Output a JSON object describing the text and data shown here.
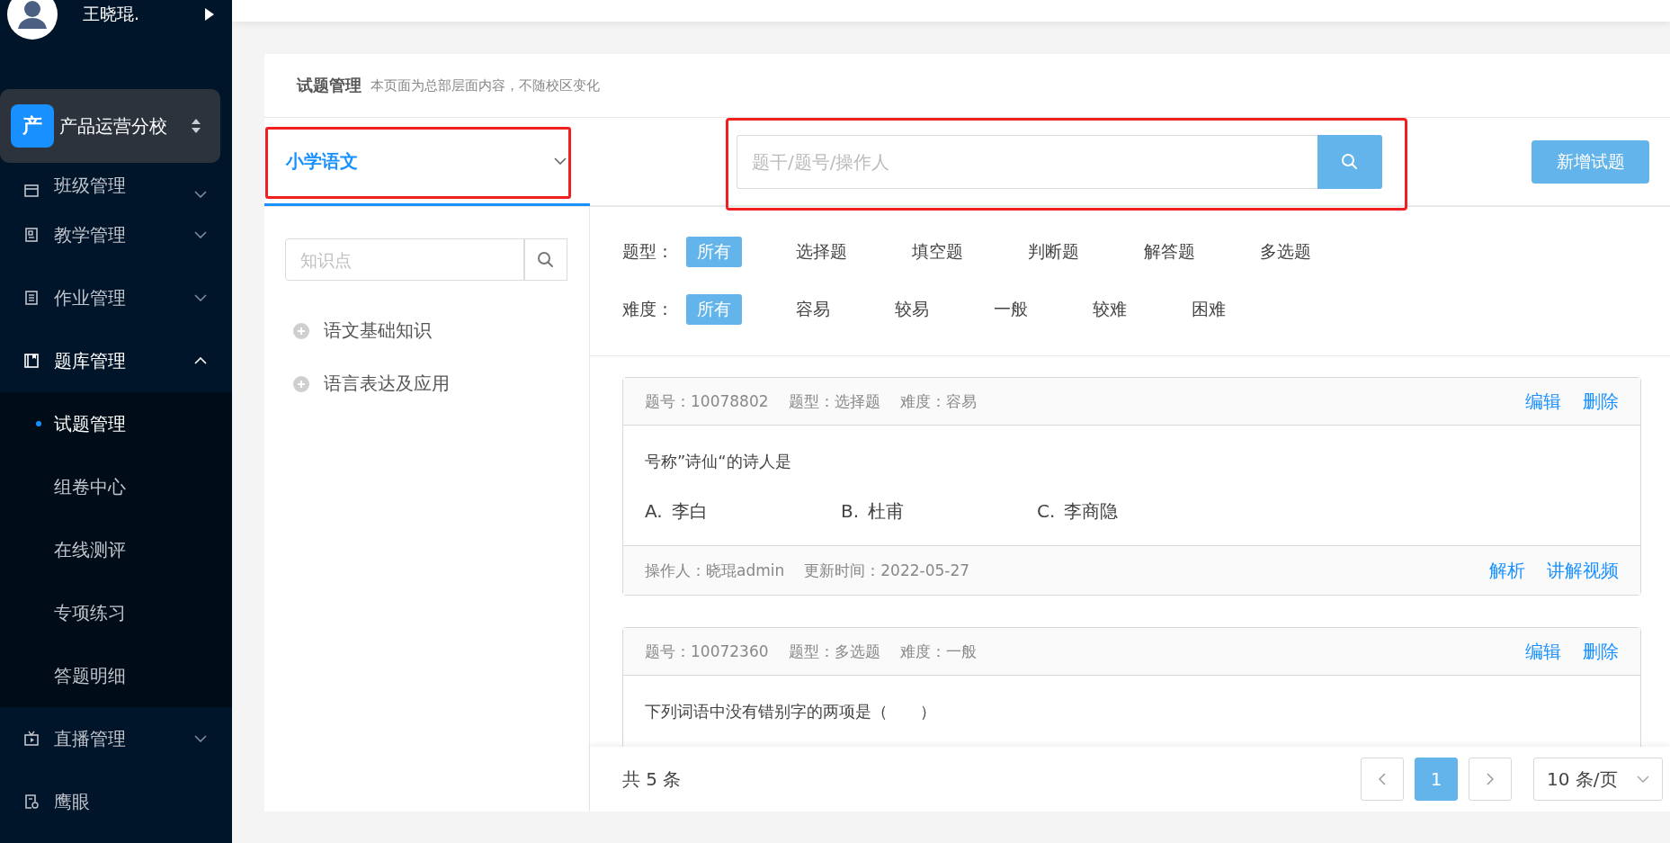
{
  "user": {
    "name": "王晓琨."
  },
  "school": {
    "badge": "产",
    "name": "产品运营分校"
  },
  "menu": [
    {
      "label": "班级管理",
      "expanded": false
    },
    {
      "label": "教学管理",
      "expanded": false
    },
    {
      "label": "作业管理",
      "expanded": false
    },
    {
      "label": "题库管理",
      "expanded": true,
      "children": [
        {
          "label": "试题管理",
          "selected": true
        },
        {
          "label": "组卷中心",
          "selected": false
        },
        {
          "label": "在线测评",
          "selected": false
        },
        {
          "label": "专项练习",
          "selected": false
        },
        {
          "label": "答题明细",
          "selected": false
        }
      ]
    },
    {
      "label": "直播管理",
      "expanded": false
    },
    {
      "label": "鹰眼"
    }
  ],
  "page": {
    "title": "试题管理",
    "note": "本页面为总部层面内容，不随校区变化"
  },
  "subject": {
    "value": "小学语文"
  },
  "search": {
    "placeholder": "题干/题号/操作人"
  },
  "add_button": "新增试题",
  "knowledge": {
    "placeholder": "知识点",
    "items": [
      {
        "label": "语文基础知识",
        "expanded": false
      },
      {
        "label": "语言表达及应用",
        "expanded": false
      }
    ]
  },
  "filters": [
    {
      "label": "题型：",
      "options": [
        {
          "label": "所有",
          "selected": true
        },
        {
          "label": "选择题",
          "selected": false
        },
        {
          "label": "填空题",
          "selected": false
        },
        {
          "label": "判断题",
          "selected": false
        },
        {
          "label": "解答题",
          "selected": false
        },
        {
          "label": "多选题",
          "selected": false
        }
      ]
    },
    {
      "label": "难度：",
      "options": [
        {
          "label": "所有",
          "selected": true
        },
        {
          "label": "容易",
          "selected": false
        },
        {
          "label": "较易",
          "selected": false
        },
        {
          "label": "一般",
          "selected": false
        },
        {
          "label": "较难",
          "selected": false
        },
        {
          "label": "困难",
          "selected": false
        }
      ]
    }
  ],
  "questions": [
    {
      "meta": [
        "题号：10078802",
        "题型：选择题",
        "难度：容易"
      ],
      "actions": [
        "编辑",
        "删除"
      ],
      "stem": "号称”诗仙“的诗人是",
      "options": [
        {
          "letter": "A.",
          "text": "李白"
        },
        {
          "letter": "B.",
          "text": "杜甫"
        },
        {
          "letter": "C.",
          "text": "李商隐"
        }
      ],
      "footer": [
        "操作人：晓琨admin",
        "更新时间：2022-05-27"
      ],
      "footer_actions": [
        "解析",
        "讲解视频"
      ]
    },
    {
      "meta": [
        "题号：10072360",
        "题型：多选题",
        "难度：一般"
      ],
      "actions": [
        "编辑",
        "删除"
      ],
      "stem": "下列词语中没有错别字的两项是（　　）"
    }
  ],
  "pagination": {
    "total": "共 5 条",
    "pages": [
      {
        "label": "1",
        "selected": true
      }
    ],
    "page_size": "10 条/页"
  }
}
